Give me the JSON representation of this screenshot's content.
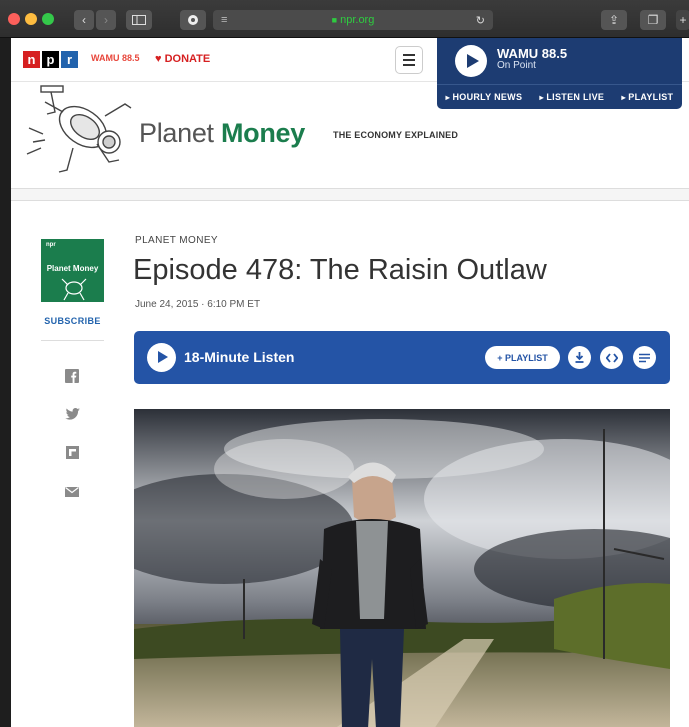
{
  "browser": {
    "url": "npr.org"
  },
  "header": {
    "logo_letters": [
      "n",
      "p",
      "r"
    ],
    "station": "WAMU 88.5",
    "donate": "DONATE"
  },
  "player": {
    "station": "WAMU 88.5",
    "show": "On Point",
    "links": [
      "HOURLY NEWS",
      "LISTEN LIVE",
      "PLAYLIST"
    ]
  },
  "brand": {
    "title_light": "Planet ",
    "title_bold": "Money",
    "tagline": "THE ECONOMY EXPLAINED"
  },
  "sidebar": {
    "podcast_art_npr": "npr",
    "podcast_art_title": "Planet Money",
    "subscribe": "SUBSCRIBE",
    "share_icons": [
      "facebook-icon",
      "twitter-icon",
      "flipboard-icon",
      "email-icon"
    ]
  },
  "article": {
    "kicker": "PLANET MONEY",
    "headline": "Episode 478: The Raisin Outlaw",
    "date": "June 24, 2015 · 6:10 PM ET"
  },
  "audio": {
    "label": "18-Minute Listen",
    "playlist_button": "+ PLAYLIST"
  },
  "colors": {
    "npr_red": "#d62021",
    "npr_black": "#000000",
    "npr_blue": "#2263ad",
    "planet_money_green": "#1b7d4d",
    "audio_blue": "#2454a6",
    "player_navy": "#1d3c72"
  }
}
